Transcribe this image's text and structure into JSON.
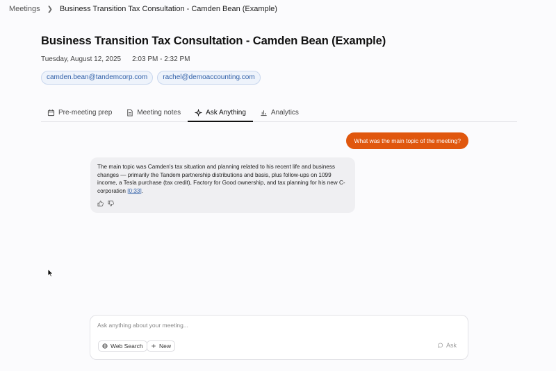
{
  "breadcrumb": {
    "root": "Meetings",
    "current": "Business Transition Tax Consultation - Camden Bean (Example)"
  },
  "meeting": {
    "title": "Business Transition Tax Consultation - Camden Bean (Example)",
    "date": "Tuesday, August 12, 2025",
    "time": "2:03 PM - 2:32 PM",
    "attendees": [
      "camden.bean@tandemcorp.com",
      "rachel@demoaccounting.com"
    ]
  },
  "tabs": [
    {
      "label": "Pre-meeting prep",
      "icon": "calendar-icon"
    },
    {
      "label": "Meeting notes",
      "icon": "document-icon"
    },
    {
      "label": "Ask Anything",
      "icon": "sparkle-icon",
      "active": true
    },
    {
      "label": "Analytics",
      "icon": "bar-chart-icon"
    }
  ],
  "chat": {
    "user_message": "What was the main topic of the meeting?",
    "ai_response": "The main topic was Camden's tax situation and planning related to his recent life and business changes — primarily the Tandem partnership distributions and basis, plus follow-ups on 1099 income, a Tesla purchase (tax credit), Factory for Good ownership, and tax planning for his new C-corporation ",
    "ai_citation": "[0:33]",
    "ai_suffix": "."
  },
  "composer": {
    "placeholder": "Ask anything about your meeting...",
    "web_search_label": "Web Search",
    "new_label": "New",
    "ask_label": "Ask"
  },
  "colors": {
    "accent": "#e0570e",
    "link": "#2f5fa8"
  }
}
